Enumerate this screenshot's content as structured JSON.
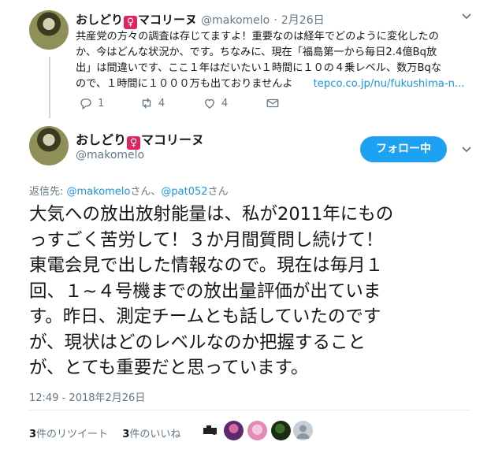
{
  "tweet1": {
    "name_prefix": "おしどり",
    "venus": "♀",
    "name_suffix": "マコリーヌ",
    "handle": "@makomelo",
    "date_sep": "·",
    "date": "2月26日",
    "lines": [
      "共産党の方々の調査は存じてますよ！重要なのは経年でどのように変化したの",
      "か、今はどんな状況か、です。ちなみに、現在「福島第一から毎日2.4億Bq放",
      "出」は間違いです、ここ１年はだいたい１時間に１０の４乗レベル、数万Bqな"
    ],
    "last_line": "ので、１時間に１０００万も出ておりませんよ",
    "link": "tepco.co.jp/nu/fukushima-n...",
    "reply_count": "1",
    "retweet_count": "4",
    "like_count": "4"
  },
  "tweet2": {
    "name_prefix": "おしどり",
    "venus": "♀",
    "name_suffix": "マコリーヌ",
    "handle": "@makomelo",
    "follow_label": "フォロー中",
    "reply_prefix": "返信先: ",
    "reply_user1": "@makomelo",
    "reply_san1": "さん、",
    "reply_user2": "@pat052",
    "reply_san2": "さん",
    "lines": [
      "大気への放出放射能量は、私が2011年にもの",
      "っすごく苦労して！３か月間質問し続けて！",
      "東電会見で出した情報なので。現在は毎月１",
      "回、１~４号機までの放出量評価が出ていま",
      "す。昨日、測定チームとも話していたのです",
      "が、現状はどのレベルなのか把握すること",
      "が、とても重要だと思っています。"
    ],
    "timestamp": "12:49 - 2018年2月26日",
    "retweets_num": "3",
    "retweets_label": "件のリツイート",
    "likes_num": "3",
    "likes_label": "件のいいね"
  },
  "colors": {
    "accent": "#1da1f2",
    "link": "#1b95e0",
    "muted": "#657786",
    "venus_badge": "#e0245e"
  }
}
